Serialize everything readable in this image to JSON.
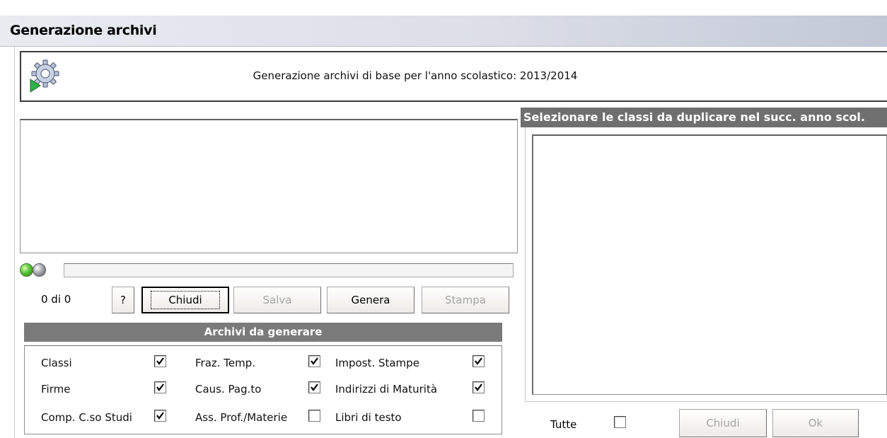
{
  "window": {
    "title": "Generazione archivi"
  },
  "header": {
    "text": "Generazione archivi di base per l'anno scolastico: 2013/2014"
  },
  "progress": {
    "counter": "0 di 0",
    "value": 0
  },
  "buttons": {
    "help": "?",
    "close": "Chiudi",
    "save": "Salva",
    "generate": "Genera",
    "print": "Stampa"
  },
  "archives": {
    "title": "Archivi da generare",
    "items": [
      {
        "label": "Classi",
        "checked": true
      },
      {
        "label": "Fraz. Temp.",
        "checked": true
      },
      {
        "label": "Impost. Stampe",
        "checked": true
      },
      {
        "label": "Firme",
        "checked": true
      },
      {
        "label": "Caus. Pag.to",
        "checked": true
      },
      {
        "label": "Indirizzi di Maturità",
        "checked": true
      },
      {
        "label": "Comp. C.so Studi",
        "checked": true
      },
      {
        "label": "Ass. Prof./Materie",
        "checked": false
      },
      {
        "label": "Libri di testo",
        "checked": false
      }
    ]
  },
  "classes": {
    "title": "Selezionare le classi da duplicare nel succ. anno scol.",
    "all_label": "Tutte",
    "all_checked": false,
    "close_label": "Chiudi",
    "ok_label": "Ok"
  }
}
